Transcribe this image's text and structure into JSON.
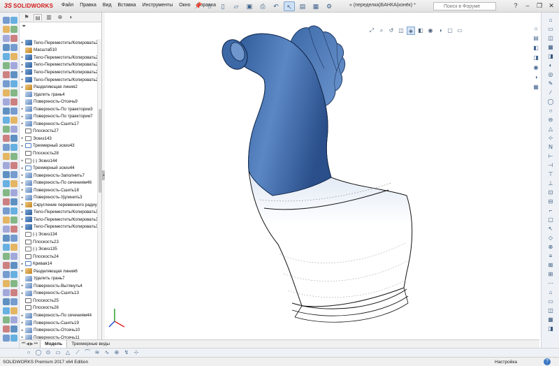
{
  "app": {
    "logo_mark": "3S",
    "logo_text": "SOLIDWORKS",
    "document_title": "« (переделка)БАНКА(конёк) *"
  },
  "menu": [
    "Файл",
    "Правка",
    "Вид",
    "Вставка",
    "Инструменты",
    "Окно",
    "Справка"
  ],
  "search": {
    "placeholder": "Поиск в Форуме"
  },
  "feature_tree": {
    "items": [
      {
        "label": "Тело-Переместить/Копировать2",
        "icon": "body"
      },
      {
        "label": "Масштаб10",
        "icon": "feat"
      },
      {
        "label": "Тело-Переместить/Копировать2",
        "icon": "body"
      },
      {
        "label": "Тело-Переместить/Копировать2",
        "icon": "body"
      },
      {
        "label": "Тело-Переместить/Копировать2",
        "icon": "body"
      },
      {
        "label": "Тело-Переместить/Копировать2",
        "icon": "body"
      },
      {
        "label": "Разделяющая линия2",
        "icon": "feat"
      },
      {
        "label": "Удалить грань4",
        "icon": "surf"
      },
      {
        "label": "Поверхность-Отсечь9",
        "icon": "surf"
      },
      {
        "label": "Поверхность-По траектории3",
        "icon": "surf"
      },
      {
        "label": "Поверхность-По траектории7",
        "icon": "surf"
      },
      {
        "label": "Поверхность-Сшить17",
        "icon": "surf"
      },
      {
        "label": "Плоскость27",
        "icon": "plane"
      },
      {
        "label": "Эскиз143",
        "icon": "sketch"
      },
      {
        "label": "Трехмерный эскиз43",
        "icon": "3d"
      },
      {
        "label": "Плоскость28",
        "icon": "plane"
      },
      {
        "label": "(-) Эскиз144",
        "icon": "sketch"
      },
      {
        "label": "Трехмерный эскиз44",
        "icon": "3d"
      },
      {
        "label": "Поверхность-Заполнить7",
        "icon": "surf"
      },
      {
        "label": "Поверхность-По сечениям46",
        "icon": "surf"
      },
      {
        "label": "Поверхность-Сшить18",
        "icon": "surf"
      },
      {
        "label": "Поверхность-Удлинить3",
        "icon": "surf"
      },
      {
        "label": "Скругление переменного радиуса",
        "icon": "feat"
      },
      {
        "label": "Тело-Переместить/Копировать3",
        "icon": "body"
      },
      {
        "label": "Тело-Переместить/Копировать3",
        "icon": "body"
      },
      {
        "label": "Тело-Переместить/Копировать3",
        "icon": "body"
      },
      {
        "label": "(-) Эскиз134",
        "icon": "sketch"
      },
      {
        "label": "Плоскость23",
        "icon": "plane"
      },
      {
        "label": "(-) Эскиз135",
        "icon": "sketch"
      },
      {
        "label": "Плоскость24",
        "icon": "plane"
      },
      {
        "label": "Кривая14",
        "icon": "3d"
      },
      {
        "label": "Разделяющая линия6",
        "icon": "feat"
      },
      {
        "label": "Удалить грань7",
        "icon": "surf"
      },
      {
        "label": "Поверхность-Вытянуть4",
        "icon": "surf"
      },
      {
        "label": "Поверхность-Сшить13",
        "icon": "surf"
      },
      {
        "label": "Плоскость25",
        "icon": "plane"
      },
      {
        "label": "Плоскость26",
        "icon": "plane"
      },
      {
        "label": "Поверхность-По сечениям44",
        "icon": "surf"
      },
      {
        "label": "Поверхность-Сшить19",
        "icon": "surf"
      },
      {
        "label": "Поверхность-Отсечь10",
        "icon": "surf"
      },
      {
        "label": "Поверхность-Отсечь11",
        "icon": "surf"
      }
    ]
  },
  "bottom_tabs": [
    "Модель",
    "Трехмерные виды"
  ],
  "status": {
    "edition": "SOLIDWORKS Premium 2017 x64 Edition",
    "custom": "Настройка",
    "help": "?"
  },
  "colors": {
    "model_blue": "#3f6fae",
    "accent": "#d31a1a"
  }
}
